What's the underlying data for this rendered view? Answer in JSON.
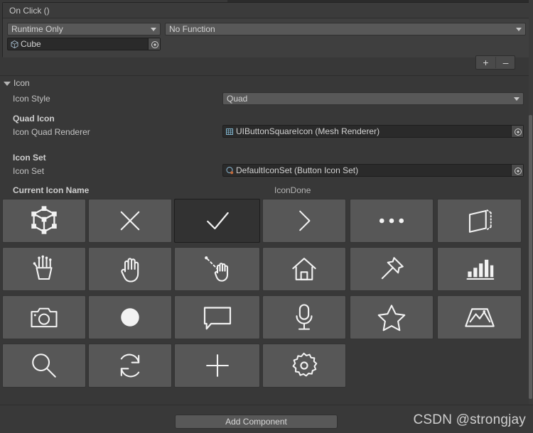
{
  "window": {
    "background": "#383838",
    "accent": "#575757"
  },
  "on_click_panel": {
    "title": "On Click ()",
    "mode_dropdown": {
      "value": "Runtime Only",
      "icon": "chevron-down-icon"
    },
    "function_dropdown": {
      "value": "No Function",
      "icon": "chevron-down-icon"
    },
    "target_object_field": {
      "value": "Cube",
      "type_icon": "cube-prefab-icon",
      "picker_icon": "object-picker-icon"
    },
    "add_button_label": "+",
    "remove_button_label": "–"
  },
  "icon_section": {
    "foldout_label": "Icon",
    "foldout_icon": "triangle-down-icon",
    "icon_style": {
      "label": "Icon Style",
      "value": "Quad",
      "icon": "chevron-down-icon"
    },
    "quad_icon": {
      "group_label": "Quad Icon",
      "field_label": "Icon Quad Renderer",
      "value": "UIButtonSquareIcon (Mesh Renderer)",
      "type_icon": "mesh-renderer-icon",
      "picker_icon": "object-picker-icon"
    },
    "icon_set": {
      "group_label": "Icon Set",
      "field_label": "Icon Set",
      "value": "DefaultIconSet (Button Icon Set)",
      "type_icon": "scriptable-object-icon",
      "picker_icon": "object-picker-icon"
    },
    "current_icon": {
      "label": "Current Icon Name",
      "value": "IconDone"
    },
    "grid": {
      "columns": 6,
      "selected_index": 2,
      "items": [
        {
          "name": "icon-cube-wireframe",
          "label": "IconCubeWireframe"
        },
        {
          "name": "icon-close",
          "label": "IconClose"
        },
        {
          "name": "icon-done",
          "label": "IconDone"
        },
        {
          "name": "icon-chevron-right",
          "label": "IconChevronRight"
        },
        {
          "name": "icon-ellipsis",
          "label": "IconEllipsis"
        },
        {
          "name": "icon-slate",
          "label": "IconSlate"
        },
        {
          "name": "icon-hand-articulated",
          "label": "IconHandArticulated"
        },
        {
          "name": "icon-hand-open",
          "label": "IconHandOpen"
        },
        {
          "name": "icon-hand-ray",
          "label": "IconHandRay"
        },
        {
          "name": "icon-home",
          "label": "IconHome"
        },
        {
          "name": "icon-pin",
          "label": "IconPin"
        },
        {
          "name": "icon-chart",
          "label": "IconChart"
        },
        {
          "name": "icon-camera",
          "label": "IconCamera"
        },
        {
          "name": "icon-record",
          "label": "IconRecord"
        },
        {
          "name": "icon-speech-bubble",
          "label": "IconSpeechBubble"
        },
        {
          "name": "icon-microphone",
          "label": "IconMicrophone"
        },
        {
          "name": "icon-star",
          "label": "IconStar"
        },
        {
          "name": "icon-map",
          "label": "IconMap"
        },
        {
          "name": "icon-search",
          "label": "IconSearch"
        },
        {
          "name": "icon-refresh",
          "label": "IconRefresh"
        },
        {
          "name": "icon-add",
          "label": "IconAdd"
        },
        {
          "name": "icon-settings",
          "label": "IconSettings"
        }
      ]
    }
  },
  "footer": {
    "add_component_label": "Add Component",
    "watermark": "CSDN @strongjay"
  }
}
